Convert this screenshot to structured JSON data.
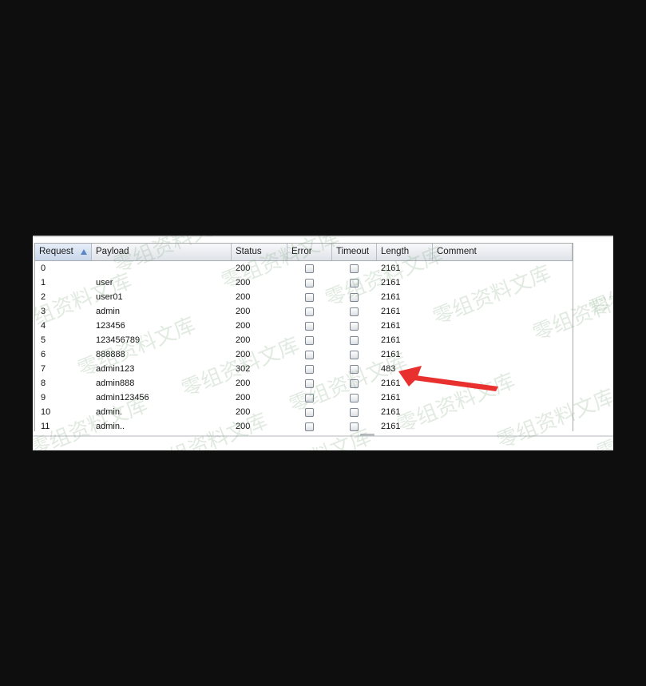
{
  "columns": {
    "request": "Request",
    "payload": "Payload",
    "status": "Status",
    "error": "Error",
    "timeout": "Timeout",
    "length": "Length",
    "comment": "Comment"
  },
  "sort": {
    "column": "Request",
    "direction": "ascending"
  },
  "rows": [
    {
      "request": "0",
      "payload": "",
      "status": "200",
      "length": "2161"
    },
    {
      "request": "1",
      "payload": "user",
      "status": "200",
      "length": "2161"
    },
    {
      "request": "2",
      "payload": "user01",
      "status": "200",
      "length": "2161"
    },
    {
      "request": "3",
      "payload": "admin",
      "status": "200",
      "length": "2161"
    },
    {
      "request": "4",
      "payload": "123456",
      "status": "200",
      "length": "2161"
    },
    {
      "request": "5",
      "payload": "123456789",
      "status": "200",
      "length": "2161"
    },
    {
      "request": "6",
      "payload": "888888",
      "status": "200",
      "length": "2161"
    },
    {
      "request": "7",
      "payload": "admin123",
      "status": "302",
      "length": "483"
    },
    {
      "request": "8",
      "payload": "admin888",
      "status": "200",
      "length": "2161"
    },
    {
      "request": "9",
      "payload": "admin123456",
      "status": "200",
      "length": "2161"
    },
    {
      "request": "10",
      "payload": "admin.",
      "status": "200",
      "length": "2161"
    },
    {
      "request": "11",
      "payload": "admin..",
      "status": "200",
      "length": "2161"
    }
  ],
  "watermark": "零组资料文库",
  "annotation": {
    "target_row": "7",
    "color": "#e8312f"
  },
  "colors": {
    "page_background": "#0e0e0f",
    "header_sorted": "#c9d7ea",
    "sort_arrow": "#5b86c4"
  }
}
